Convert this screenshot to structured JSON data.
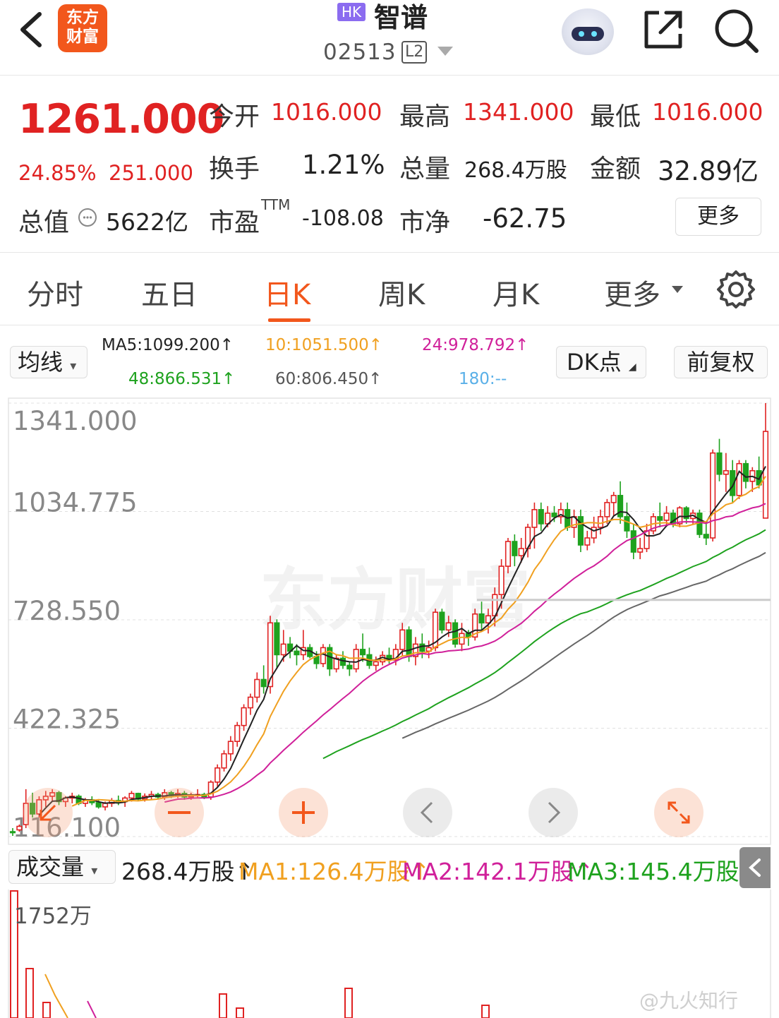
{
  "header": {
    "logo_line1": "东方",
    "logo_line2": "财富",
    "market_badge": "HK",
    "stock_name": "智谱",
    "stock_code": "02513",
    "level_badge": "L2"
  },
  "quote": {
    "price": "1261.000",
    "change_pct": "24.85%",
    "change_amt": "251.000",
    "open_label": "今开",
    "open_value": "1016.000",
    "high_label": "最高",
    "high_value": "1341.000",
    "low_label": "最低",
    "low_value": "1016.000",
    "turnover_label": "换手",
    "turnover_value": "1.21%",
    "volume_label": "总量",
    "volume_value": "268.4万股",
    "amount_label": "金额",
    "amount_value": "32.89亿",
    "mktcap_label": "总值",
    "mktcap_value": "5622亿",
    "pe_label": "市盈",
    "pe_sup": "TTM",
    "pe_value": "-108.08",
    "pb_label": "市净",
    "pb_value": "-62.75",
    "more_label": "更多"
  },
  "tabs": [
    "分时",
    "五日",
    "日K",
    "周K",
    "月K",
    "更多"
  ],
  "active_tab": "日K",
  "ma_legend": {
    "selector": "均线",
    "ma5": "MA5:1099.200↑",
    "ma10": "10:1051.500↑",
    "ma24": "24:978.792↑",
    "ma48": "48:866.531↑",
    "ma60": "60:806.450↑",
    "ma180": "180:--",
    "dk_button": "DK点",
    "adjust_button": "前复权"
  },
  "colors": {
    "up": "#e02222",
    "down": "#1ea21e",
    "ma5": "#222222",
    "ma10": "#f0a020",
    "ma24": "#d0209a",
    "ma48": "#1ea21e",
    "ma60": "#666666",
    "ma180": "#5ab0e8",
    "accent": "#f2571c"
  },
  "chart_data": {
    "type": "candlestick",
    "y_ticks": [
      "1341.000",
      "1034.775",
      "728.550",
      "422.325",
      "116.100"
    ],
    "ylim": [
      116.1,
      1341.0
    ],
    "candles": [
      [
        130,
        140,
        118,
        128
      ],
      [
        135,
        150,
        130,
        145
      ],
      [
        150,
        250,
        140,
        210
      ],
      [
        210,
        240,
        170,
        180
      ],
      [
        180,
        230,
        170,
        220
      ],
      [
        220,
        245,
        200,
        230
      ],
      [
        230,
        250,
        215,
        240
      ],
      [
        240,
        245,
        205,
        215
      ],
      [
        215,
        230,
        200,
        225
      ],
      [
        225,
        240,
        210,
        230
      ],
      [
        230,
        235,
        205,
        210
      ],
      [
        210,
        225,
        200,
        220
      ],
      [
        220,
        230,
        205,
        212
      ],
      [
        212,
        222,
        195,
        200
      ],
      [
        200,
        215,
        190,
        210
      ],
      [
        210,
        225,
        200,
        218
      ],
      [
        218,
        232,
        205,
        215
      ],
      [
        215,
        230,
        200,
        225
      ],
      [
        225,
        245,
        215,
        238
      ],
      [
        238,
        240,
        218,
        222
      ],
      [
        222,
        238,
        215,
        230
      ],
      [
        230,
        245,
        220,
        235
      ],
      [
        235,
        240,
        222,
        228
      ],
      [
        228,
        250,
        220,
        240
      ],
      [
        240,
        245,
        225,
        232
      ],
      [
        232,
        250,
        225,
        238
      ],
      [
        238,
        245,
        220,
        228
      ],
      [
        228,
        240,
        220,
        232
      ],
      [
        232,
        250,
        225,
        235
      ],
      [
        235,
        240,
        222,
        228
      ],
      [
        228,
        275,
        220,
        270
      ],
      [
        270,
        320,
        255,
        310
      ],
      [
        310,
        360,
        300,
        350
      ],
      [
        350,
        400,
        330,
        385
      ],
      [
        385,
        440,
        370,
        430
      ],
      [
        430,
        490,
        415,
        480
      ],
      [
        480,
        520,
        460,
        510
      ],
      [
        510,
        580,
        495,
        560
      ],
      [
        560,
        600,
        520,
        540
      ],
      [
        540,
        740,
        520,
        720
      ],
      [
        720,
        730,
        590,
        630
      ],
      [
        630,
        700,
        610,
        660
      ],
      [
        660,
        680,
        620,
        640
      ],
      [
        640,
        660,
        600,
        630
      ],
      [
        630,
        700,
        615,
        650
      ],
      [
        650,
        660,
        620,
        625
      ],
      [
        625,
        640,
        590,
        605
      ],
      [
        605,
        660,
        595,
        650
      ],
      [
        650,
        660,
        570,
        590
      ],
      [
        590,
        630,
        580,
        620
      ],
      [
        620,
        640,
        590,
        600
      ],
      [
        600,
        610,
        570,
        590
      ],
      [
        590,
        660,
        580,
        645
      ],
      [
        645,
        690,
        610,
        630
      ],
      [
        630,
        650,
        590,
        600
      ],
      [
        600,
        625,
        585,
        610
      ],
      [
        610,
        640,
        600,
        628
      ],
      [
        628,
        650,
        605,
        615
      ],
      [
        615,
        660,
        600,
        645
      ],
      [
        645,
        720,
        625,
        700
      ],
      [
        700,
        710,
        610,
        625
      ],
      [
        625,
        680,
        600,
        660
      ],
      [
        660,
        690,
        620,
        640
      ],
      [
        640,
        670,
        620,
        650
      ],
      [
        650,
        760,
        640,
        750
      ],
      [
        750,
        760,
        690,
        700
      ],
      [
        700,
        740,
        680,
        720
      ],
      [
        720,
        730,
        650,
        660
      ],
      [
        660,
        720,
        640,
        690
      ],
      [
        690,
        700,
        655,
        680
      ],
      [
        680,
        760,
        670,
        745
      ],
      [
        745,
        780,
        700,
        720
      ],
      [
        720,
        760,
        690,
        740
      ],
      [
        740,
        820,
        710,
        800
      ],
      [
        800,
        900,
        760,
        880
      ],
      [
        880,
        960,
        860,
        950
      ],
      [
        950,
        970,
        880,
        910
      ],
      [
        910,
        960,
        890,
        930
      ],
      [
        930,
        1000,
        905,
        990
      ],
      [
        990,
        1060,
        930,
        1040
      ],
      [
        1040,
        1060,
        980,
        1000
      ],
      [
        1000,
        1050,
        990,
        1030
      ],
      [
        1030,
        1050,
        1005,
        1020
      ],
      [
        1020,
        1060,
        1000,
        1040
      ],
      [
        1040,
        1060,
        980,
        990
      ],
      [
        990,
        1040,
        960,
        1020
      ],
      [
        1020,
        1040,
        920,
        940
      ],
      [
        940,
        980,
        925,
        960
      ],
      [
        960,
        1020,
        945,
        990
      ],
      [
        990,
        1040,
        970,
        1020
      ],
      [
        1020,
        1070,
        1000,
        1060
      ],
      [
        1060,
        1090,
        1020,
        1080
      ],
      [
        1080,
        1120,
        1000,
        1020
      ],
      [
        1020,
        1060,
        960,
        980
      ],
      [
        980,
        1000,
        900,
        920
      ],
      [
        920,
        960,
        900,
        930
      ],
      [
        930,
        1000,
        920,
        980
      ],
      [
        980,
        1030,
        970,
        1020
      ],
      [
        1020,
        1060,
        990,
        1010
      ],
      [
        1010,
        1050,
        995,
        1030
      ],
      [
        1030,
        1040,
        990,
        1000
      ],
      [
        1000,
        1050,
        990,
        1045
      ],
      [
        1045,
        1050,
        1000,
        1015
      ],
      [
        1015,
        1040,
        1000,
        1030
      ],
      [
        1030,
        1040,
        960,
        970
      ],
      [
        970,
        1000,
        940,
        960
      ],
      [
        960,
        1210,
        950,
        1200
      ],
      [
        1200,
        1240,
        1120,
        1140
      ],
      [
        1140,
        1200,
        1090,
        1150
      ],
      [
        1150,
        1180,
        1060,
        1080
      ],
      [
        1080,
        1180,
        1070,
        1170
      ],
      [
        1170,
        1180,
        1100,
        1120
      ],
      [
        1120,
        1160,
        1090,
        1150
      ],
      [
        1150,
        1190,
        1100,
        1110
      ],
      [
        1016,
        1341,
        1016,
        1261
      ]
    ],
    "ma_series": [
      {
        "name": "MA5"
      },
      {
        "name": "10"
      },
      {
        "name": "24"
      },
      {
        "name": "48"
      },
      {
        "name": "60"
      }
    ]
  },
  "volume": {
    "selector": "成交量",
    "total": "268.4万股↑",
    "ma1": "MA1:126.4万股↑",
    "ma2": "MA2:142.1万股↑",
    "ma3": "MA3:145.4万股↑",
    "max_label": "1752万"
  },
  "watermark_text": "@九火知行",
  "bg_watermark": "东方财富",
  "icons": [
    "back-arrow-icon",
    "share-icon",
    "search-icon",
    "settings-gear-icon",
    "info-smile-icon",
    "plus-icon",
    "chevron-left-icon",
    "chevron-right-icon",
    "expand-icon",
    "minus-icon",
    "arrow-icon"
  ]
}
